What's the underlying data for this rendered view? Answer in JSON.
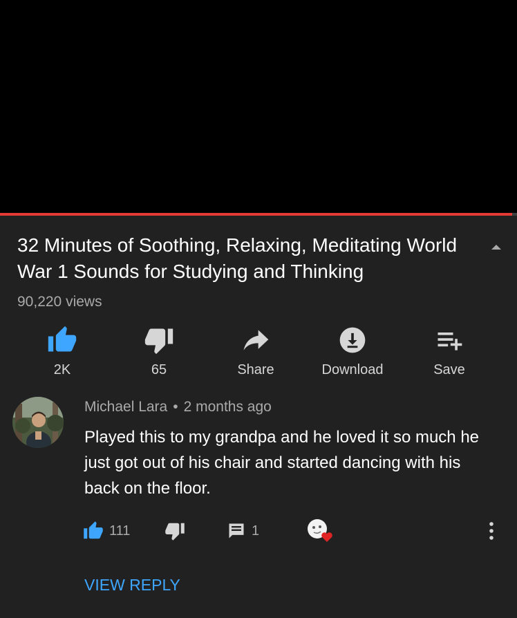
{
  "video": {
    "title": "32 Minutes of Soothing, Relaxing, Meditating World War 1 Sounds for Studying and Thinking",
    "views": "90,220 views",
    "progress_fraction": 0.99
  },
  "actions": {
    "like_label": "2K",
    "dislike_label": "65",
    "share_label": "Share",
    "download_label": "Download",
    "save_label": "Save"
  },
  "comment": {
    "author": "Michael Lara",
    "separator": "•",
    "time": "2 months ago",
    "text": "Played this to my grandpa and he loved it so much he just got out of his chair and started dancing with his back on the floor.",
    "like_count": "111",
    "reply_count": "1",
    "view_reply_label": "VIEW REPLY"
  },
  "icons": {
    "collapse": "chevron-up-icon",
    "like": "thumbs-up-icon",
    "dislike": "thumbs-down-icon",
    "share": "share-arrow-icon",
    "download": "download-icon",
    "save": "playlist-add-icon",
    "reply": "comment-icon",
    "creator_heart": "creator-heart-icon",
    "more": "more-vertical-icon"
  },
  "colors": {
    "background": "#212121",
    "player": "#000000",
    "progress": "#e53935",
    "like_active": "#3ea6ff",
    "link": "#3ea6ff",
    "secondary_text": "#aaaaaa"
  }
}
